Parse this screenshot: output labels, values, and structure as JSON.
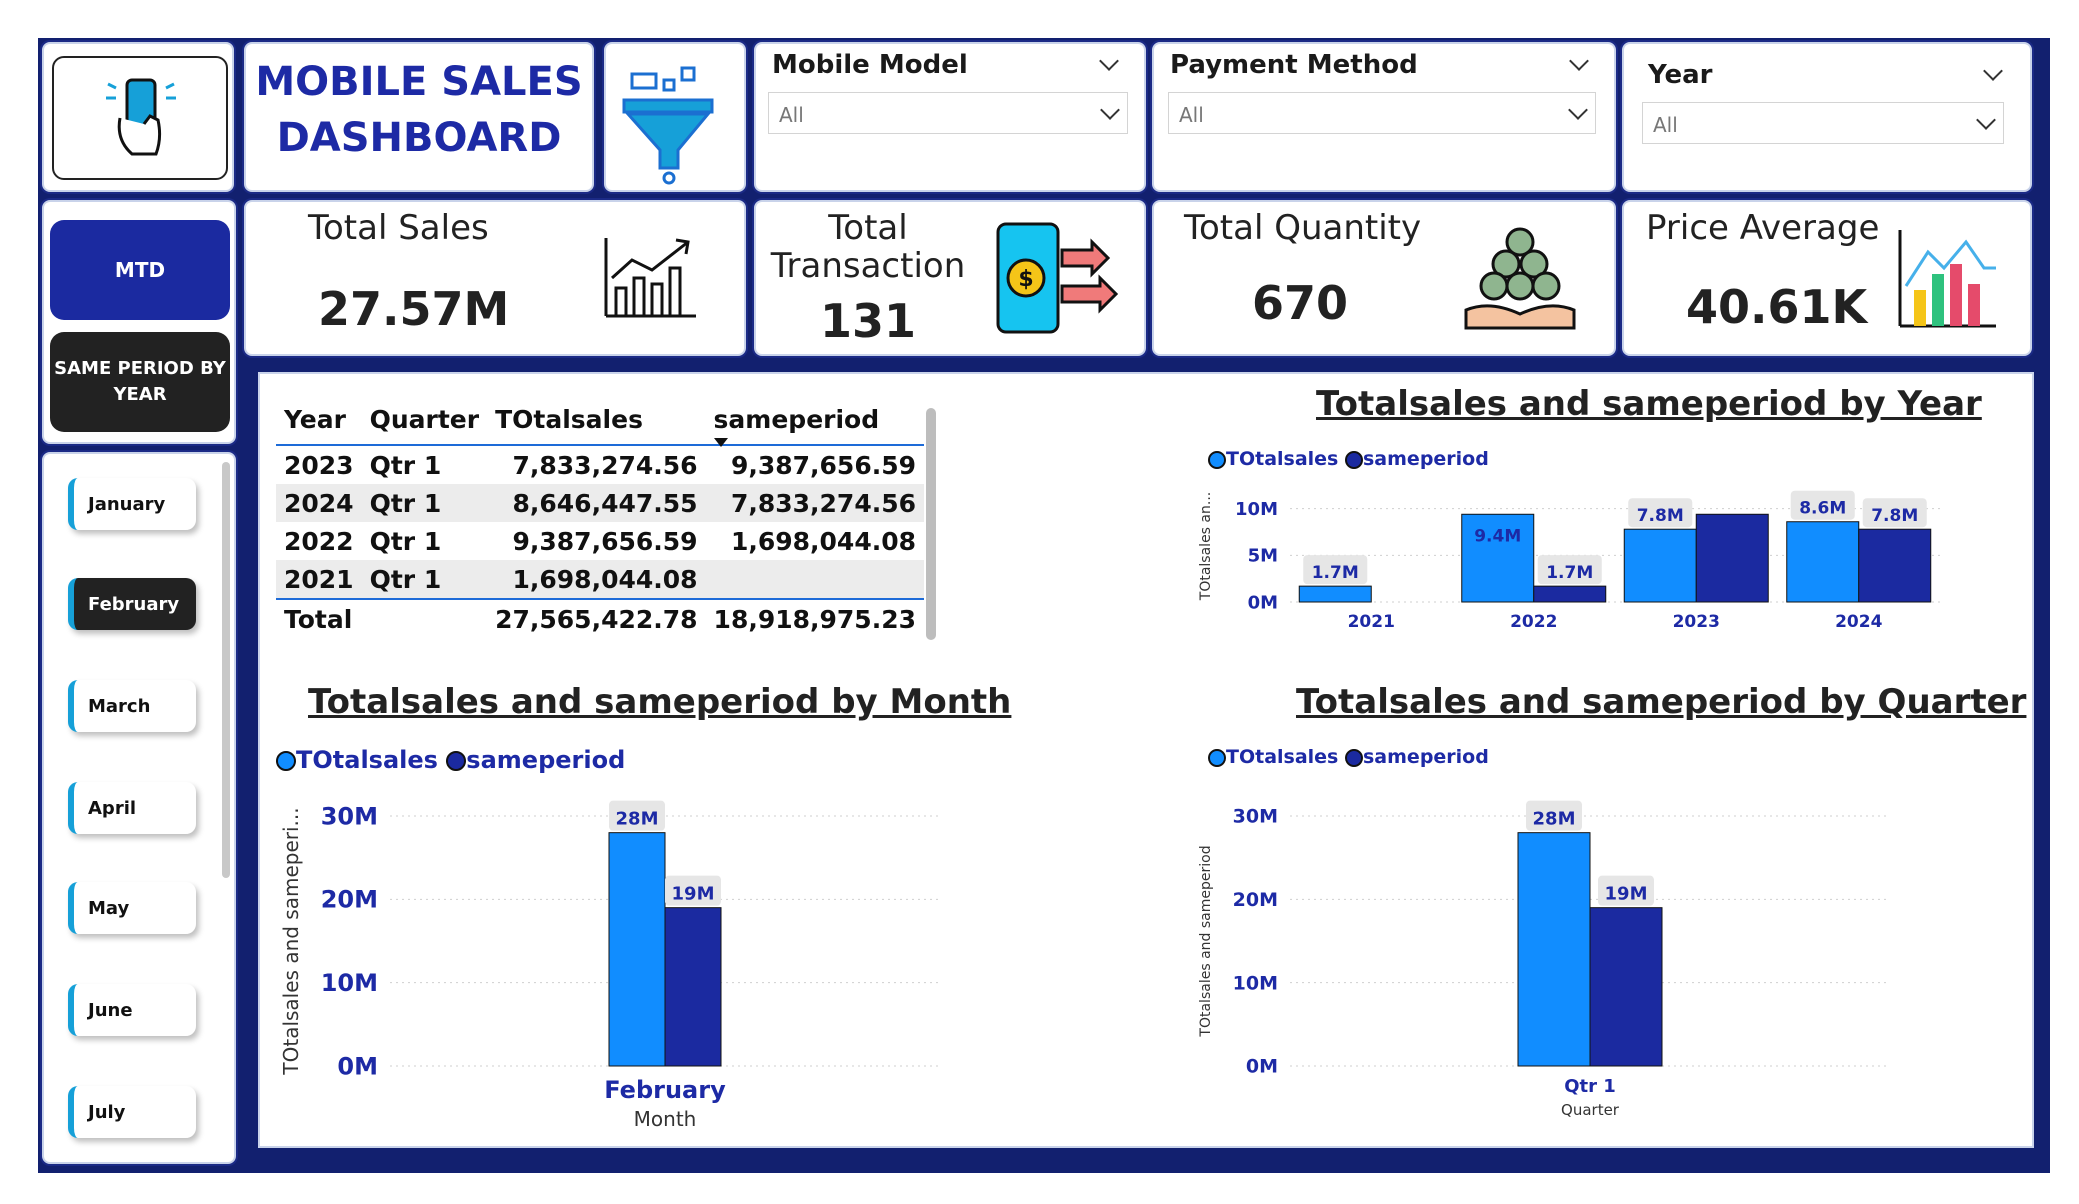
{
  "header": {
    "title_line1": "MOBILE SALES",
    "title_line2": "DASHBOARD"
  },
  "filters": {
    "mobile_model": {
      "label": "Mobile Model",
      "value": "All"
    },
    "payment_method": {
      "label": "Payment Method",
      "value": "All"
    },
    "year": {
      "label": "Year",
      "value": "All"
    }
  },
  "buttons": {
    "mtd": "MTD",
    "same_period": "SAME PERIOD BY YEAR"
  },
  "months": [
    "January",
    "February",
    "March",
    "April",
    "May",
    "June",
    "July"
  ],
  "selected_month": "February",
  "kpis": {
    "total_sales": {
      "label": "Total Sales",
      "value": "27.57M"
    },
    "total_transaction": {
      "label_line1": "Total",
      "label_line2": "Transaction",
      "value": "131"
    },
    "total_quantity": {
      "label": "Total Quantity",
      "value": "670"
    },
    "price_average": {
      "label": "Price Average",
      "value": "40.61K"
    }
  },
  "table": {
    "headers": [
      "Year",
      "Quarter",
      "TOtalsales",
      "sameperiod"
    ],
    "rows": [
      [
        "2023",
        "Qtr 1",
        "7,833,274.56",
        "9,387,656.59"
      ],
      [
        "2024",
        "Qtr 1",
        "8,646,447.55",
        "7,833,274.56"
      ],
      [
        "2022",
        "Qtr 1",
        "9,387,656.59",
        "1,698,044.08"
      ],
      [
        "2021",
        "Qtr 1",
        "1,698,044.08",
        ""
      ]
    ],
    "total": [
      "Total",
      "",
      "27,565,422.78",
      "18,918,975.23"
    ]
  },
  "colors": {
    "navy": "#12206f",
    "totalsales": "#118dff",
    "sameperiod": "#1b2aa0",
    "accent_blue": "#1d2aa5"
  },
  "chart_data": [
    {
      "type": "bar",
      "title": "Totalsales and sameperiod by Year",
      "ylabel": "TOtalsales an...",
      "xlabel": "",
      "categories": [
        "2021",
        "2022",
        "2023",
        "2024"
      ],
      "series": [
        {
          "name": "TOtalsales",
          "values": [
            1.7,
            9.4,
            7.8,
            8.6
          ],
          "labels": [
            "1.7M",
            "9.4M",
            "7.8M",
            "8.6M"
          ]
        },
        {
          "name": "sameperiod",
          "values": [
            null,
            1.7,
            9.4,
            7.8
          ],
          "labels": [
            "",
            "1.7M",
            "",
            "7.8M"
          ]
        }
      ],
      "yticks": [
        "0M",
        "5M",
        "10M"
      ],
      "ylim": [
        0,
        12
      ],
      "legend": "top-left"
    },
    {
      "type": "bar",
      "title": "Totalsales and sameperiod by Month",
      "ylabel": "TOtalsales and sameperi...",
      "xlabel": "Month",
      "categories": [
        "February"
      ],
      "series": [
        {
          "name": "TOtalsales",
          "values": [
            28
          ],
          "labels": [
            "28M"
          ]
        },
        {
          "name": "sameperiod",
          "values": [
            19
          ],
          "labels": [
            "19M"
          ]
        }
      ],
      "yticks": [
        "0M",
        "10M",
        "20M",
        "30M"
      ],
      "ylim": [
        0,
        30
      ],
      "legend": "top-left"
    },
    {
      "type": "bar",
      "title": "Totalsales and sameperiod by Quarter",
      "ylabel": "TOtalsales and sameperiod",
      "xlabel": "Quarter",
      "categories": [
        "Qtr 1"
      ],
      "series": [
        {
          "name": "TOtalsales",
          "values": [
            28
          ],
          "labels": [
            "28M"
          ]
        },
        {
          "name": "sameperiod",
          "values": [
            19
          ],
          "labels": [
            "19M"
          ]
        }
      ],
      "yticks": [
        "0M",
        "10M",
        "20M",
        "30M"
      ],
      "ylim": [
        0,
        30
      ],
      "legend": "top-left"
    }
  ]
}
